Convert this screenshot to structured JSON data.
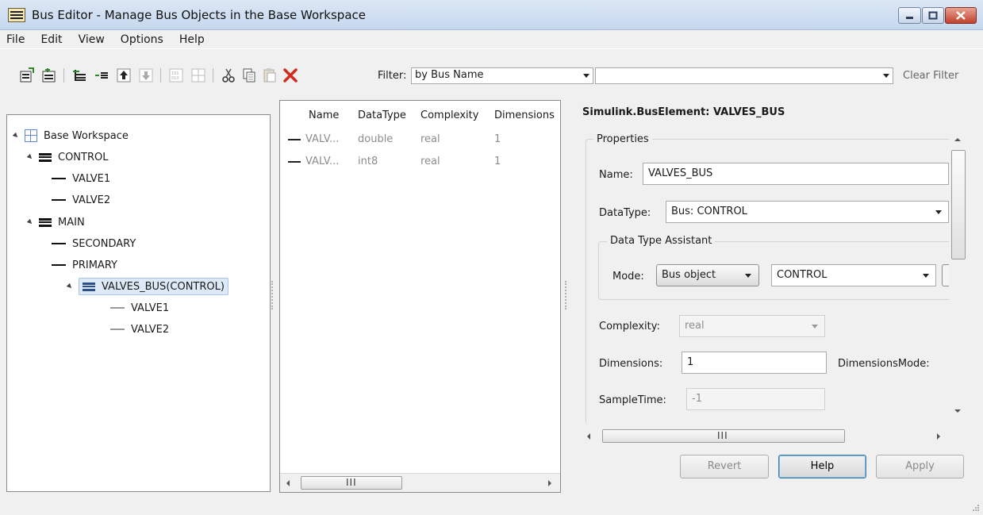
{
  "window": {
    "title": "Bus Editor - Manage Bus Objects in the Base Workspace"
  },
  "menu": [
    "File",
    "Edit",
    "View",
    "Options",
    "Help"
  ],
  "toolbar": {
    "icons": [
      "new-bus-icon",
      "new-bus-element-icon",
      "insert-element-icon",
      "insert-sibling-icon",
      "move-up-icon",
      "move-down-icon",
      "import-icon",
      "grid-icon",
      "cut-icon",
      "copy-icon",
      "paste-icon",
      "delete-icon"
    ],
    "filter_label": "Filter:",
    "filter_mode": "by Bus Name",
    "filter_text": "",
    "clear_filter_label": "Clear Filter"
  },
  "tree": {
    "root": "Base Workspace",
    "control": "CONTROL",
    "control_children": [
      "VALVE1",
      "VALVE2"
    ],
    "main": "MAIN",
    "main_children": [
      "SECONDARY",
      "PRIMARY"
    ],
    "valves_bus": "VALVES_BUS(CONTROL)",
    "valves_bus_children": [
      "VALVE1",
      "VALVE2"
    ]
  },
  "table": {
    "columns": [
      "Name",
      "DataType",
      "Complexity",
      "Dimensions"
    ],
    "rows": [
      {
        "name": "VALV...",
        "datatype": "double",
        "complexity": "real",
        "dimensions": "1"
      },
      {
        "name": "VALV...",
        "datatype": "int8",
        "complexity": "real",
        "dimensions": "1"
      }
    ]
  },
  "properties": {
    "title": "Simulink.BusElement: VALVES_BUS",
    "group_label": "Properties",
    "name_label": "Name:",
    "name_value": "VALVES_BUS",
    "datatype_label": "DataType:",
    "datatype_value": "Bus: CONTROL",
    "assistant_label": "Data Type Assistant",
    "mode_label": "Mode:",
    "mode_value": "Bus object",
    "mode_target": "CONTROL",
    "complexity_label": "Complexity:",
    "complexity_value": "real",
    "dimensions_label": "Dimensions:",
    "dimensions_value": "1",
    "dimensionsmode_label": "DimensionsMode:",
    "sampletime_label": "SampleTime:",
    "sampletime_value": "-1"
  },
  "buttons": {
    "revert": "Revert",
    "help": "Help",
    "apply": "Apply"
  },
  "scroll_glyph": "III"
}
